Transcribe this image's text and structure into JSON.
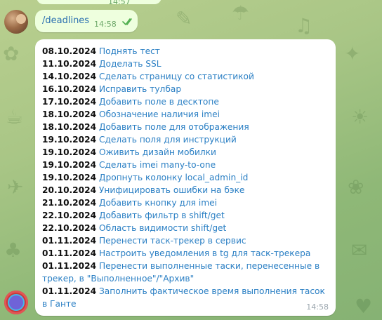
{
  "previous": {
    "time": "14:57"
  },
  "command": {
    "text": "/deadlines",
    "time": "14:58"
  },
  "reply": {
    "time": "14:58",
    "items": [
      {
        "date": "08.10.2024",
        "task": "Поднять тест"
      },
      {
        "date": "11.10.2024",
        "task": "Доделать SSL"
      },
      {
        "date": "14.10.2024",
        "task": "Сделать страницу со статистикой"
      },
      {
        "date": "16.10.2024",
        "task": "Исправить тулбар"
      },
      {
        "date": "17.10.2024",
        "task": "Добавить поле в десктопе"
      },
      {
        "date": "18.10.2024",
        "task": "Обозначение наличия imei"
      },
      {
        "date": "18.10.2024",
        "task": "Добавить поле для отображения"
      },
      {
        "date": "19.10.2024",
        "task": "Сделать поля для инструкций"
      },
      {
        "date": "19.10.2024",
        "task": "Оживить дизайн мобилки"
      },
      {
        "date": "19.10.2024",
        "task": "Сделать imei many-to-one"
      },
      {
        "date": "19.10.2024",
        "task": "Дропнуть колонку local_admin_id"
      },
      {
        "date": "20.10.2024",
        "task": "Унифицировать ошибки на бэке"
      },
      {
        "date": "21.10.2024",
        "task": "Добавить кнопку для imei"
      },
      {
        "date": "22.10.2024",
        "task": "Добавить фильтр в shift/get"
      },
      {
        "date": "22.10.2024",
        "task": "Область видимости shift/get"
      },
      {
        "date": "01.11.2024",
        "task": "Перенести таск-трекер в сервис"
      },
      {
        "date": "01.11.2024",
        "task": "Настроить уведомления в tg для таск-трекера"
      },
      {
        "date": "01.11.2024",
        "task": "Перенести выполненные таски, перенесенные в трекер, в \"Выполненное\"/\"Архив\""
      },
      {
        "date": "01.11.2024",
        "task": "Заполнить фактическое время выполнения тасок в Ганте"
      }
    ]
  },
  "colors": {
    "link": "#2a7fc4",
    "outgoing_bubble": "#eeffde",
    "incoming_bubble": "#ffffff",
    "check": "#4fae4e"
  },
  "icons": {
    "read_status": "double-check-icon",
    "user_avatar": "user-avatar",
    "bot_avatar": "bot-avatar"
  }
}
